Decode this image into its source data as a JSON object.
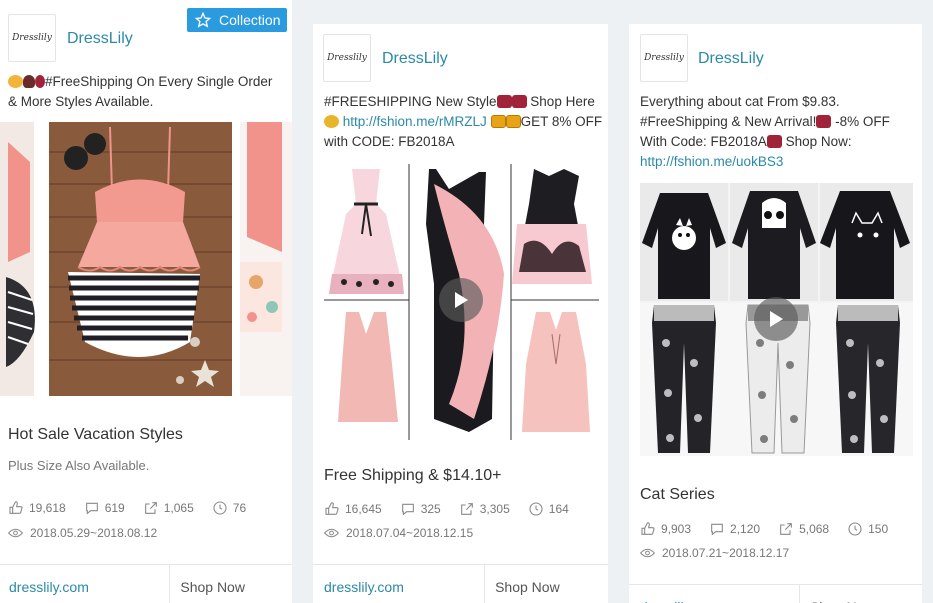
{
  "cards": [
    {
      "brand": "DressLily",
      "logo_text": "Dresslily",
      "caption_parts": [
        "#FreeShipping On Every Single Order & More Styles Available."
      ],
      "title": "Hot Sale Vacation Styles",
      "subtitle": "Plus Size Also Available.",
      "likes": "19,618",
      "comments": "619",
      "shares": "1,065",
      "views": "76",
      "date_range": "2018.05.29~2018.08.12",
      "footer_url": "dresslily.com",
      "footer_cta": "Shop Now",
      "collection_label": "Collection",
      "media": "swimsuit-carousel"
    },
    {
      "brand": "DressLily",
      "logo_text": "Dresslily",
      "caption_a": "#FREESHIPPING New Style",
      "caption_b": " Shop Here",
      "caption_link": "http://fshion.me/rMRZLJ",
      "caption_c": "GET 8% OFF with CODE: FB2018A",
      "title": "Free Shipping & $14.10+",
      "likes": "16,645",
      "comments": "325",
      "shares": "3,305",
      "views": "164",
      "date_range": "2018.07.04~2018.12.15",
      "footer_url": "dresslily.com",
      "footer_cta": "Shop Now",
      "media": "dress-grid-video"
    },
    {
      "brand": "DressLily",
      "logo_text": "Dresslily",
      "caption_a": "Everything about cat From $9.83. #FreeShipping & New Arrival!",
      "caption_b": " -8% OFF With Code: FB2018A",
      "caption_c": " Shop Now:",
      "caption_link": "http://fshion.me/uokBS3",
      "title": "Cat Series",
      "likes": "9,903",
      "comments": "2,120",
      "shares": "5,068",
      "views": "150",
      "date_range": "2018.07.21~2018.12.17",
      "footer_url": "dresslily.com",
      "footer_cta": "Shop Now",
      "media": "cat-shirt-pants-grid-video"
    }
  ],
  "colors": {
    "accent": "#2b8aa8",
    "button": "#2b9be0",
    "background": "#eef1f4"
  }
}
